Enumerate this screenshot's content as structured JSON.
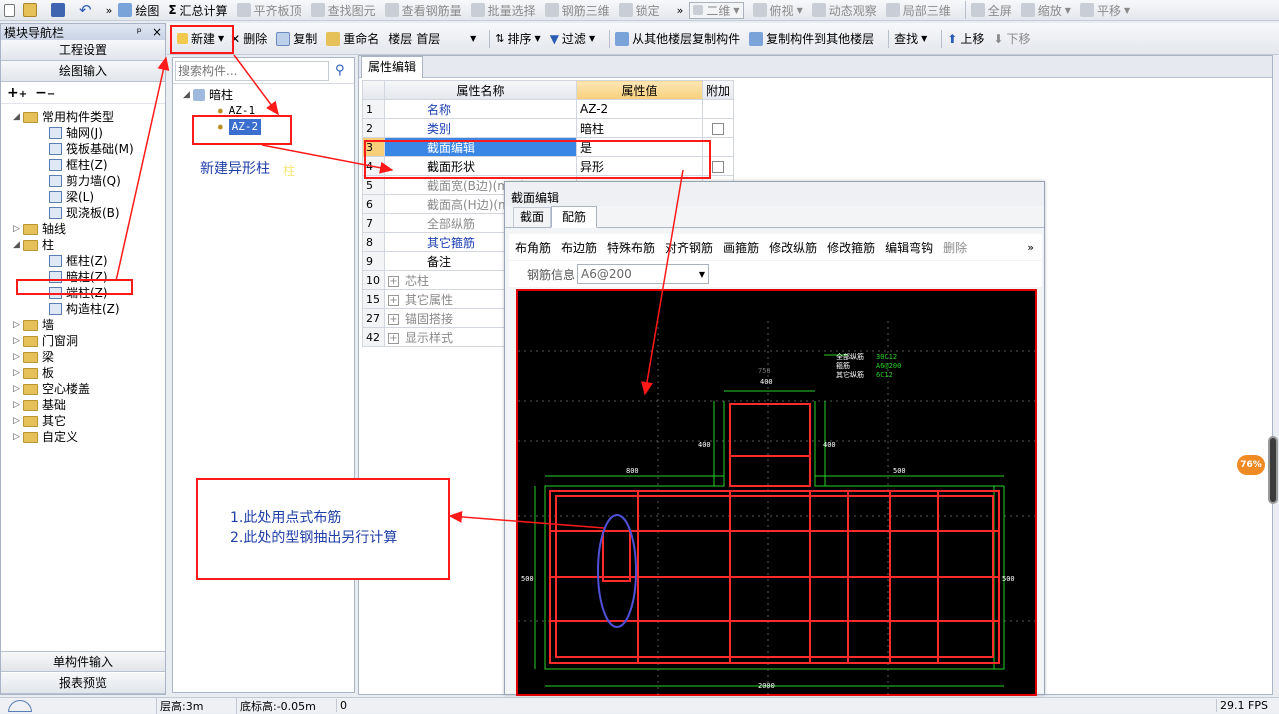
{
  "toolbar1": {
    "left": [
      "绘图",
      "汇总计算",
      "平齐板顶",
      "查找图元",
      "查看钢筋量",
      "批量选择",
      "钢筋三维",
      "锁定"
    ],
    "view_select": "二维",
    "right": [
      "俯视",
      "动态观察",
      "局部三维",
      "全屏",
      "缩放",
      "平移"
    ]
  },
  "nav": {
    "title": "模块导航栏",
    "pin": "ᵖ",
    "close": "×",
    "buttons": [
      "工程设置",
      "绘图输入"
    ],
    "bottom_buttons": [
      "单构件输入",
      "报表预览"
    ],
    "tree": [
      {
        "label": "常用构件类型",
        "level": 0,
        "type": "folder",
        "open": true
      },
      {
        "label": "轴网(J)",
        "level": 1,
        "type": "item"
      },
      {
        "label": "筏板基础(M)",
        "level": 1,
        "type": "item"
      },
      {
        "label": "框柱(Z)",
        "level": 1,
        "type": "item"
      },
      {
        "label": "剪力墙(Q)",
        "level": 1,
        "type": "item"
      },
      {
        "label": "梁(L)",
        "level": 1,
        "type": "item"
      },
      {
        "label": "现浇板(B)",
        "level": 1,
        "type": "item"
      },
      {
        "label": "轴线",
        "level": 0,
        "type": "folder",
        "open": false
      },
      {
        "label": "柱",
        "level": 0,
        "type": "folder",
        "open": true
      },
      {
        "label": "框柱(Z)",
        "level": 1,
        "type": "item"
      },
      {
        "label": "暗柱(Z)",
        "level": 1,
        "type": "item"
      },
      {
        "label": "端柱(Z)",
        "level": 1,
        "type": "item"
      },
      {
        "label": "构造柱(Z)",
        "level": 1,
        "type": "item"
      },
      {
        "label": "墙",
        "level": 0,
        "type": "folder",
        "open": false
      },
      {
        "label": "门窗洞",
        "level": 0,
        "type": "folder",
        "open": false
      },
      {
        "label": "梁",
        "level": 0,
        "type": "folder",
        "open": false
      },
      {
        "label": "板",
        "level": 0,
        "type": "folder",
        "open": false
      },
      {
        "label": "空心楼盖",
        "level": 0,
        "type": "folder",
        "open": false
      },
      {
        "label": "基础",
        "level": 0,
        "type": "folder",
        "open": false
      },
      {
        "label": "其它",
        "level": 0,
        "type": "folder",
        "open": false
      },
      {
        "label": "自定义",
        "level": 0,
        "type": "folder",
        "open": false
      }
    ]
  },
  "toolbar2": {
    "new": "新建",
    "delete": "删除",
    "copy": "复制",
    "rename": "重命名",
    "floor_label": "楼层",
    "floor_value": "首层",
    "sort": "排序",
    "filter": "过滤",
    "copy_from": "从其他楼层复制构件",
    "copy_to": "复制构件到其他楼层",
    "find": "查找",
    "up": "上移",
    "down": "下移"
  },
  "component_list": {
    "search_placeholder": "搜索构件...",
    "root": "暗柱",
    "items": [
      "AZ-1",
      "AZ-2"
    ],
    "selected": "AZ-2"
  },
  "annotation_new": "新建异形柱",
  "annotation_faint": "柱",
  "prop_tab": "属性编辑",
  "prop_table": {
    "headers": [
      "属性名称",
      "属性值",
      "附加"
    ],
    "rows": [
      {
        "num": "1",
        "name": "名称",
        "value": "AZ-2",
        "check": false,
        "blue": true
      },
      {
        "num": "2",
        "name": "类别",
        "value": "暗柱",
        "check": true,
        "blue": true
      },
      {
        "num": "3",
        "name": "截面编辑",
        "value": "是",
        "check": false,
        "blue": true,
        "selected": true
      },
      {
        "num": "4",
        "name": "截面形状",
        "value": "异形",
        "check": true,
        "blue": false
      },
      {
        "num": "5",
        "name": "截面宽(B边)(mm)",
        "value": "",
        "check": false,
        "gray": true
      },
      {
        "num": "6",
        "name": "截面高(H边)(mm)",
        "value": "",
        "check": false,
        "gray": true
      },
      {
        "num": "7",
        "name": "全部纵筋",
        "value": "",
        "check": false,
        "gray": true
      },
      {
        "num": "8",
        "name": "其它箍筋",
        "value": "",
        "check": false,
        "blue": true
      },
      {
        "num": "9",
        "name": "备注",
        "value": "",
        "check": false
      },
      {
        "num": "10",
        "name": "芯柱",
        "value": "",
        "check": false,
        "exp": true,
        "gray": true
      },
      {
        "num": "15",
        "name": "其它属性",
        "value": "",
        "check": false,
        "exp": true,
        "gray": true
      },
      {
        "num": "27",
        "name": "锚固搭接",
        "value": "",
        "check": false,
        "exp": true,
        "gray": true
      },
      {
        "num": "42",
        "name": "显示样式",
        "value": "",
        "check": false,
        "exp": true,
        "gray": true
      }
    ]
  },
  "section": {
    "title": "截面编辑",
    "tabs": [
      "截面",
      "配筋"
    ],
    "active_tab": "配筋",
    "tools": [
      "布角筋",
      "布边筋",
      "特殊布筋",
      "对齐钢筋",
      "画箍筋",
      "修改纵筋",
      "修改箍筋",
      "编辑弯钩",
      "删除"
    ],
    "rebar_label": "钢筋信息",
    "rebar_value": "A6@200",
    "legend": [
      [
        "全部纵筋",
        "30C12"
      ],
      [
        "箍筋",
        "A6@200"
      ],
      [
        "其它纵筋",
        "6C12"
      ]
    ],
    "dims": {
      "top": "400",
      "top2": "750",
      "left_small": "400",
      "right_small": "400",
      "left_wing": "800",
      "right_wing": "500",
      "left_h": "500",
      "right_h": "500",
      "bottom": "2000"
    }
  },
  "note": {
    "line1": "1.此处用点式布筋",
    "line2": "2.此处的型钢抽出另行计算"
  },
  "badge": "76%",
  "status": {
    "floor_h": "层高:3m",
    "bottom_h": "底标高:-0.05m",
    "value": "0",
    "fps": "29.1 FPS"
  }
}
